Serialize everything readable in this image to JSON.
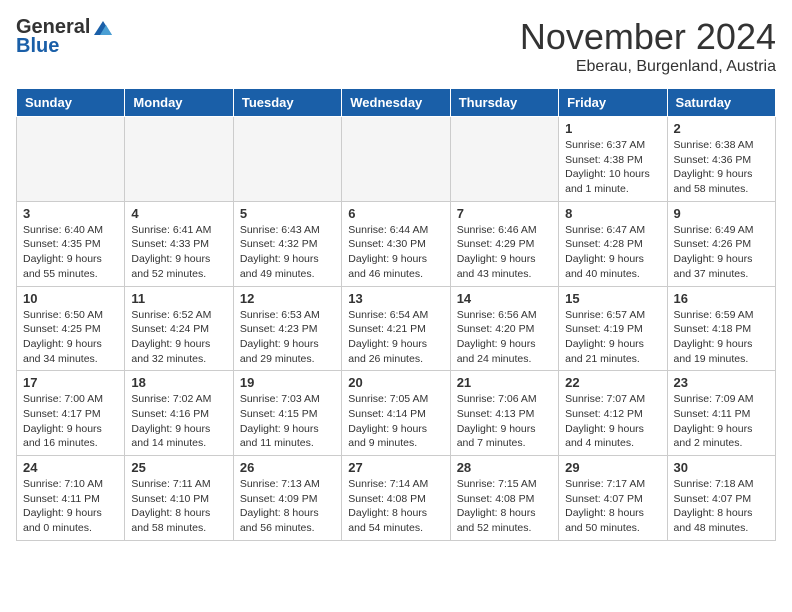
{
  "header": {
    "logo_general": "General",
    "logo_blue": "Blue",
    "month_title": "November 2024",
    "location": "Eberau, Burgenland, Austria"
  },
  "weekdays": [
    "Sunday",
    "Monday",
    "Tuesday",
    "Wednesday",
    "Thursday",
    "Friday",
    "Saturday"
  ],
  "weeks": [
    [
      {
        "num": "",
        "info": "",
        "empty": true
      },
      {
        "num": "",
        "info": "",
        "empty": true
      },
      {
        "num": "",
        "info": "",
        "empty": true
      },
      {
        "num": "",
        "info": "",
        "empty": true
      },
      {
        "num": "",
        "info": "",
        "empty": true
      },
      {
        "num": "1",
        "info": "Sunrise: 6:37 AM\nSunset: 4:38 PM\nDaylight: 10 hours\nand 1 minute."
      },
      {
        "num": "2",
        "info": "Sunrise: 6:38 AM\nSunset: 4:36 PM\nDaylight: 9 hours\nand 58 minutes."
      }
    ],
    [
      {
        "num": "3",
        "info": "Sunrise: 6:40 AM\nSunset: 4:35 PM\nDaylight: 9 hours\nand 55 minutes."
      },
      {
        "num": "4",
        "info": "Sunrise: 6:41 AM\nSunset: 4:33 PM\nDaylight: 9 hours\nand 52 minutes."
      },
      {
        "num": "5",
        "info": "Sunrise: 6:43 AM\nSunset: 4:32 PM\nDaylight: 9 hours\nand 49 minutes."
      },
      {
        "num": "6",
        "info": "Sunrise: 6:44 AM\nSunset: 4:30 PM\nDaylight: 9 hours\nand 46 minutes."
      },
      {
        "num": "7",
        "info": "Sunrise: 6:46 AM\nSunset: 4:29 PM\nDaylight: 9 hours\nand 43 minutes."
      },
      {
        "num": "8",
        "info": "Sunrise: 6:47 AM\nSunset: 4:28 PM\nDaylight: 9 hours\nand 40 minutes."
      },
      {
        "num": "9",
        "info": "Sunrise: 6:49 AM\nSunset: 4:26 PM\nDaylight: 9 hours\nand 37 minutes."
      }
    ],
    [
      {
        "num": "10",
        "info": "Sunrise: 6:50 AM\nSunset: 4:25 PM\nDaylight: 9 hours\nand 34 minutes."
      },
      {
        "num": "11",
        "info": "Sunrise: 6:52 AM\nSunset: 4:24 PM\nDaylight: 9 hours\nand 32 minutes."
      },
      {
        "num": "12",
        "info": "Sunrise: 6:53 AM\nSunset: 4:23 PM\nDaylight: 9 hours\nand 29 minutes."
      },
      {
        "num": "13",
        "info": "Sunrise: 6:54 AM\nSunset: 4:21 PM\nDaylight: 9 hours\nand 26 minutes."
      },
      {
        "num": "14",
        "info": "Sunrise: 6:56 AM\nSunset: 4:20 PM\nDaylight: 9 hours\nand 24 minutes."
      },
      {
        "num": "15",
        "info": "Sunrise: 6:57 AM\nSunset: 4:19 PM\nDaylight: 9 hours\nand 21 minutes."
      },
      {
        "num": "16",
        "info": "Sunrise: 6:59 AM\nSunset: 4:18 PM\nDaylight: 9 hours\nand 19 minutes."
      }
    ],
    [
      {
        "num": "17",
        "info": "Sunrise: 7:00 AM\nSunset: 4:17 PM\nDaylight: 9 hours\nand 16 minutes."
      },
      {
        "num": "18",
        "info": "Sunrise: 7:02 AM\nSunset: 4:16 PM\nDaylight: 9 hours\nand 14 minutes."
      },
      {
        "num": "19",
        "info": "Sunrise: 7:03 AM\nSunset: 4:15 PM\nDaylight: 9 hours\nand 11 minutes."
      },
      {
        "num": "20",
        "info": "Sunrise: 7:05 AM\nSunset: 4:14 PM\nDaylight: 9 hours\nand 9 minutes."
      },
      {
        "num": "21",
        "info": "Sunrise: 7:06 AM\nSunset: 4:13 PM\nDaylight: 9 hours\nand 7 minutes."
      },
      {
        "num": "22",
        "info": "Sunrise: 7:07 AM\nSunset: 4:12 PM\nDaylight: 9 hours\nand 4 minutes."
      },
      {
        "num": "23",
        "info": "Sunrise: 7:09 AM\nSunset: 4:11 PM\nDaylight: 9 hours\nand 2 minutes."
      }
    ],
    [
      {
        "num": "24",
        "info": "Sunrise: 7:10 AM\nSunset: 4:11 PM\nDaylight: 9 hours\nand 0 minutes."
      },
      {
        "num": "25",
        "info": "Sunrise: 7:11 AM\nSunset: 4:10 PM\nDaylight: 8 hours\nand 58 minutes."
      },
      {
        "num": "26",
        "info": "Sunrise: 7:13 AM\nSunset: 4:09 PM\nDaylight: 8 hours\nand 56 minutes."
      },
      {
        "num": "27",
        "info": "Sunrise: 7:14 AM\nSunset: 4:08 PM\nDaylight: 8 hours\nand 54 minutes."
      },
      {
        "num": "28",
        "info": "Sunrise: 7:15 AM\nSunset: 4:08 PM\nDaylight: 8 hours\nand 52 minutes."
      },
      {
        "num": "29",
        "info": "Sunrise: 7:17 AM\nSunset: 4:07 PM\nDaylight: 8 hours\nand 50 minutes."
      },
      {
        "num": "30",
        "info": "Sunrise: 7:18 AM\nSunset: 4:07 PM\nDaylight: 8 hours\nand 48 minutes."
      }
    ]
  ]
}
